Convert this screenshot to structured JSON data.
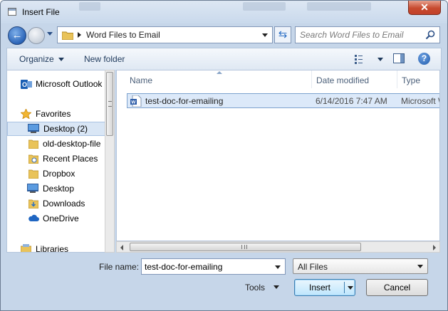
{
  "window": {
    "title": "Insert File"
  },
  "address": {
    "path": "Word Files to Email"
  },
  "search": {
    "placeholder": "Search Word Files to Email"
  },
  "toolbar": {
    "organize": "Organize",
    "new_folder": "New folder"
  },
  "nav": {
    "items": [
      {
        "label": "Microsoft Outlook",
        "icon": "outlook-icon"
      },
      {
        "label": "Favorites",
        "icon": "star-icon"
      },
      {
        "label": "Desktop (2)",
        "icon": "desktop-icon",
        "selected": true
      },
      {
        "label": "old-desktop-file",
        "icon": "folder-icon"
      },
      {
        "label": "Recent Places",
        "icon": "recent-places-icon"
      },
      {
        "label": "Dropbox",
        "icon": "dropbox-folder-icon"
      },
      {
        "label": "Desktop",
        "icon": "desktop-icon"
      },
      {
        "label": "Downloads",
        "icon": "downloads-icon"
      },
      {
        "label": "OneDrive",
        "icon": "cloud-icon"
      },
      {
        "label": "Libraries",
        "icon": "libraries-icon"
      }
    ]
  },
  "files": {
    "columns": {
      "name": "Name",
      "date": "Date modified",
      "type": "Type"
    },
    "rows": [
      {
        "name": "test-doc-for-emailing",
        "date": "6/14/2016 7:47 AM",
        "type": "Microsoft Word Document",
        "icon": "word-doc-icon"
      }
    ]
  },
  "footer": {
    "file_name_label": "File name:",
    "file_name_value": "test-doc-for-emailing",
    "filter_value": "All Files",
    "tools": "Tools",
    "insert": "Insert",
    "cancel": "Cancel"
  },
  "colors": {
    "accent": "#2b64b7",
    "selection": "#dce9f9",
    "chrome": "#c6d6e9"
  }
}
